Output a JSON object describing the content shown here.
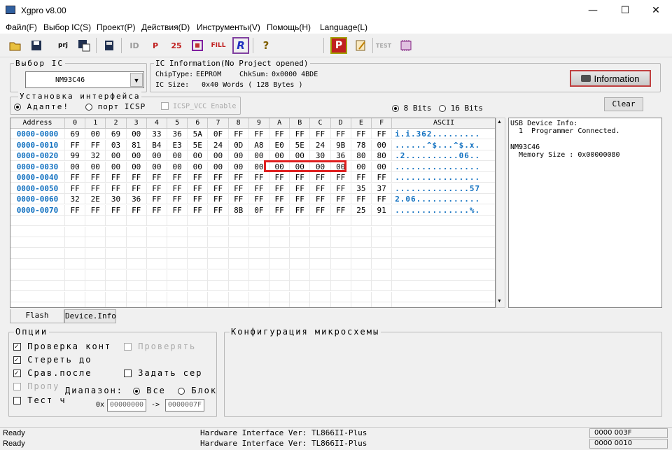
{
  "window": {
    "title": "Xgpro v8.00",
    "min": "—",
    "max": "☐",
    "close": "✕"
  },
  "menu": [
    "Файл(F)",
    "Выбор IC(S)",
    "Проект(P)",
    "Действия(D)",
    "Инструменты(V)",
    "Помощь(H)",
    "Language(L)"
  ],
  "toolbar": [
    {
      "name": "open-icon",
      "label": ""
    },
    {
      "name": "save-icon",
      "label": ""
    },
    {
      "name": "project-icon",
      "label": "prj"
    },
    {
      "name": "save-project-icon",
      "label": ""
    },
    {
      "name": "chip-save-icon",
      "label": ""
    },
    {
      "name": "read-id-icon",
      "label": "ID"
    },
    {
      "name": "program-icon",
      "label": "P"
    },
    {
      "name": "verify-icon",
      "label": "25"
    },
    {
      "name": "blank-check-icon",
      "label": ""
    },
    {
      "name": "fill-icon",
      "label": "FILL"
    },
    {
      "name": "read-icon",
      "label": "R"
    },
    {
      "name": "help-icon",
      "label": "?"
    },
    {
      "name": "prog-red-icon",
      "label": "P"
    },
    {
      "name": "edit-icon",
      "label": ""
    },
    {
      "name": "test-icon",
      "label": "TEST"
    },
    {
      "name": "chip-icon",
      "label": ""
    }
  ],
  "ic_select": {
    "legend": "Выбор IC",
    "value": "NM93C46"
  },
  "ic_info": {
    "legend": "IC Information(No Project opened)",
    "chip_type_label": "ChipType:",
    "chip_type": "EEPROM",
    "chksum_label": "ChkSum:",
    "chksum": "0x0000 4BDE",
    "size_label": "IC Size:",
    "size": "0x40 Words ( 128 Bytes )"
  },
  "info_button": "Information",
  "clear_button": "Clear",
  "interface": {
    "legend": "Установка интерфейса",
    "adapter": "Адапте!",
    "icsp_port": "порт ICSP",
    "icsp_vcc": "ICSP_VCC Enable",
    "bits8": "8 Bits",
    "bits16": "16 Bits"
  },
  "grid": {
    "headers": [
      "Address",
      "0",
      "1",
      "2",
      "3",
      "4",
      "5",
      "6",
      "7",
      "8",
      "9",
      "A",
      "B",
      "C",
      "D",
      "E",
      "F",
      "ASCII"
    ],
    "rows": [
      {
        "addr": "0000-0000",
        "bytes": [
          "69",
          "00",
          "69",
          "00",
          "33",
          "36",
          "5A",
          "0F",
          "FF",
          "FF",
          "FF",
          "FF",
          "FF",
          "FF",
          "FF",
          "FF"
        ],
        "ascii": "i.i.362........."
      },
      {
        "addr": "0000-0010",
        "bytes": [
          "FF",
          "FF",
          "03",
          "81",
          "B4",
          "E3",
          "5E",
          "24",
          "0D",
          "A8",
          "E0",
          "5E",
          "24",
          "9B",
          "78",
          "00"
        ],
        "ascii": "......^$...^$.x."
      },
      {
        "addr": "0000-0020",
        "bytes": [
          "99",
          "32",
          "00",
          "00",
          "00",
          "00",
          "00",
          "00",
          "00",
          "00",
          "00",
          "00",
          "30",
          "36",
          "80",
          "80"
        ],
        "ascii": ".2..........06.."
      },
      {
        "addr": "0000-0030",
        "bytes": [
          "00",
          "00",
          "00",
          "00",
          "00",
          "00",
          "00",
          "00",
          "00",
          "00",
          "00",
          "00",
          "00",
          "00",
          "00",
          "00"
        ],
        "ascii": "................"
      },
      {
        "addr": "0000-0040",
        "bytes": [
          "FF",
          "FF",
          "FF",
          "FF",
          "FF",
          "FF",
          "FF",
          "FF",
          "FF",
          "FF",
          "FF",
          "FF",
          "FF",
          "FF",
          "FF",
          "FF"
        ],
        "ascii": "................"
      },
      {
        "addr": "0000-0050",
        "bytes": [
          "FF",
          "FF",
          "FF",
          "FF",
          "FF",
          "FF",
          "FF",
          "FF",
          "FF",
          "FF",
          "FF",
          "FF",
          "FF",
          "FF",
          "35",
          "37"
        ],
        "ascii": "..............57"
      },
      {
        "addr": "0000-0060",
        "bytes": [
          "32",
          "2E",
          "30",
          "36",
          "FF",
          "FF",
          "FF",
          "FF",
          "FF",
          "FF",
          "FF",
          "FF",
          "FF",
          "FF",
          "FF",
          "FF"
        ],
        "ascii": "2.06............"
      },
      {
        "addr": "0000-0070",
        "bytes": [
          "FF",
          "FF",
          "FF",
          "FF",
          "FF",
          "FF",
          "FF",
          "FF",
          "8B",
          "0F",
          "FF",
          "FF",
          "FF",
          "FF",
          "25",
          "91"
        ],
        "ascii": "..............%."
      }
    ],
    "highlight_color": "#e02020"
  },
  "device_info": {
    "line1": "USB Device Info:",
    "line2": "  1  Programmer Connected.",
    "line3": "NM93C46",
    "line4": "  Memory Size : 0x00000080"
  },
  "tabs": [
    "Flash",
    "Device.Info"
  ],
  "options": {
    "legend": "Опции",
    "check_id": "Проверка конт",
    "verify": "Проверять",
    "erase": "Стереть до",
    "compare": "Срав.после",
    "set_serial": "Задать сер",
    "skip": "Пропу",
    "range": "Диапазон:",
    "all": "Все",
    "block": "Блок",
    "test": "Тест ч",
    "from_label": "0x",
    "from": "00000000",
    "to_label": "->",
    "to": "0000007F"
  },
  "config": {
    "legend": "Конфигурация микросхемы"
  },
  "status": [
    {
      "left": "Ready",
      "center": "Hardware Interface Ver: TL866II-Plus",
      "right": "0000 003F"
    },
    {
      "left": "Ready",
      "center": "Hardware Interface Ver: TL866II-Plus",
      "right": "0000 0010"
    }
  ]
}
